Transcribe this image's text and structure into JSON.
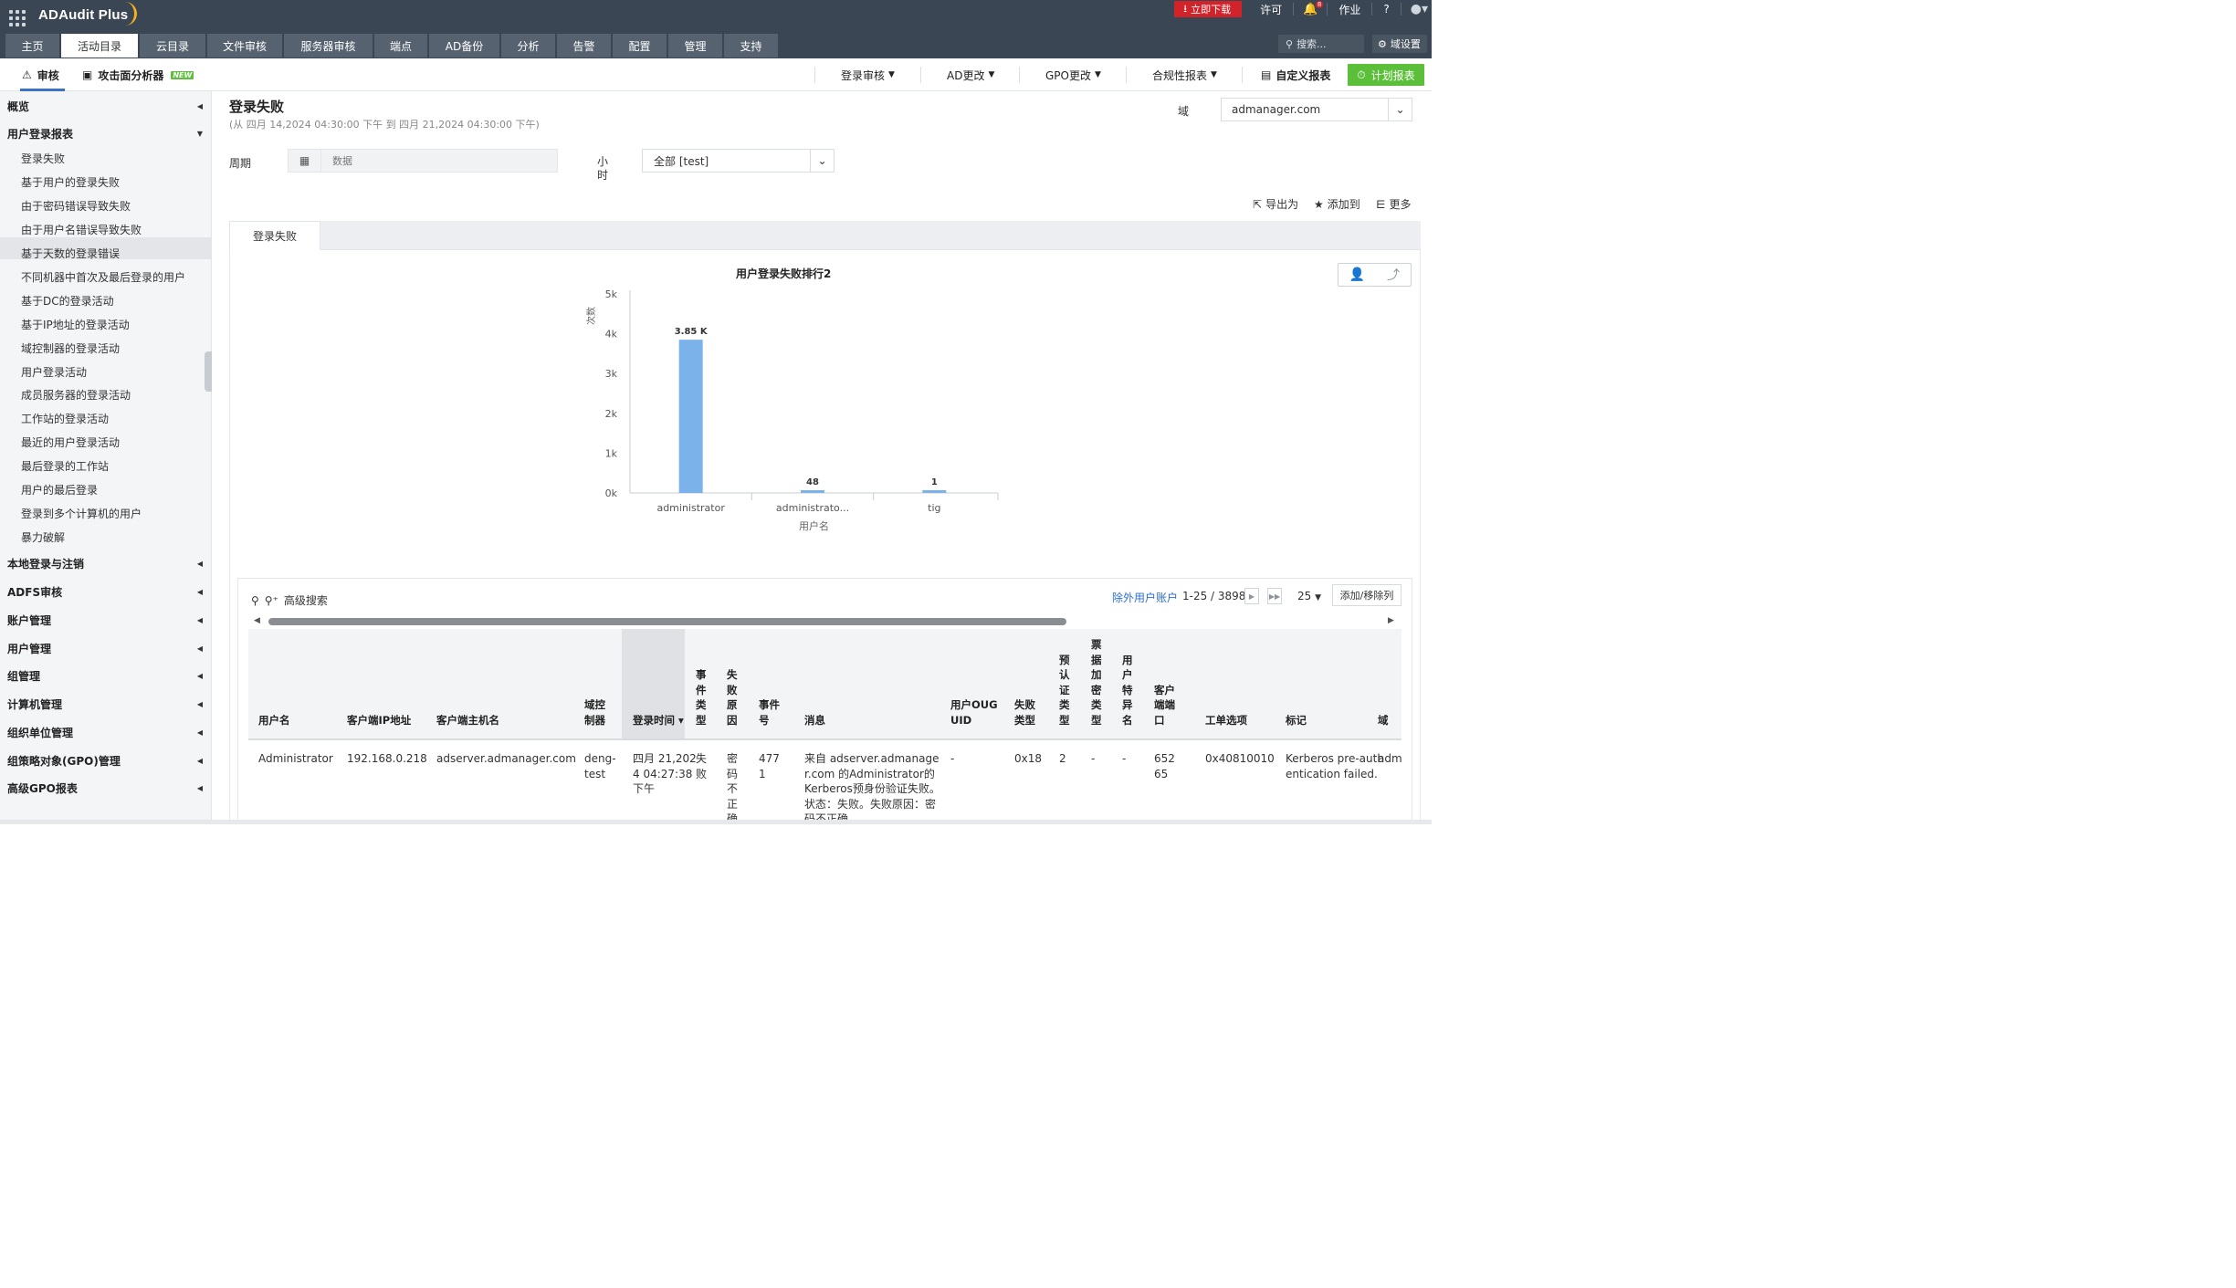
{
  "app": {
    "name": "ADAudit Plus"
  },
  "topbar": {
    "download_label": "立即下载",
    "license_label": "许可",
    "notification_count": "8",
    "jobs_label": "作业",
    "help_label": "?",
    "search_placeholder": "搜索...",
    "domain_settings_label": "域设置"
  },
  "nav_tabs": [
    {
      "label": "主页"
    },
    {
      "label": "活动目录"
    },
    {
      "label": "云目录"
    },
    {
      "label": "文件审核"
    },
    {
      "label": "服务器审核"
    },
    {
      "label": "端点"
    },
    {
      "label": "AD备份"
    },
    {
      "label": "分析"
    },
    {
      "label": "告警"
    },
    {
      "label": "配置"
    },
    {
      "label": "管理"
    },
    {
      "label": "支持"
    }
  ],
  "subbar": {
    "audit_label": "审核",
    "attack_label": "攻击面分析器",
    "new_badge": "NEW",
    "menus": [
      {
        "label": "登录审核"
      },
      {
        "label": "AD更改"
      },
      {
        "label": "GPO更改"
      },
      {
        "label": "合规性报表"
      }
    ],
    "custom_report_label": "自定义报表",
    "schedule_label": "计划报表"
  },
  "sidebar": {
    "overview": "概览",
    "user_login_reports": "用户登录报表",
    "items": [
      "登录失败",
      "基于用户的登录失败",
      "由于密码错误导致失败",
      "由于用户名错误导致失败",
      "基于天数的登录错误",
      "不同机器中首次及最后登录的用户",
      "基于DC的登录活动",
      "基于IP地址的登录活动",
      "域控制器的登录活动",
      "用户登录活动",
      "成员服务器的登录活动",
      "工作站的登录活动",
      "最近的用户登录活动",
      "最后登录的工作站",
      "用户的最后登录",
      "登录到多个计算机的用户",
      "暴力破解"
    ],
    "sections": [
      "本地登录与注销",
      "ADFS审核",
      "账户管理",
      "用户管理",
      "组管理",
      "计算机管理",
      "组织单位管理",
      "组策略对象(GPO)管理",
      "高级GPO报表"
    ]
  },
  "report": {
    "title": "登录失败",
    "range": "(从 四月 14,2024 04:30:00 下午 到 四月 21,2024 04:30:00 下午)",
    "domain_label": "域",
    "domain_value": "admanager.com",
    "period_label": "周期",
    "period_value": "数据",
    "hour_label": "小时",
    "hour_value": "全部 [test]",
    "export_label": "导出为",
    "add_to_label": "添加到",
    "more_label": "更多",
    "tab_label": "登录失败"
  },
  "chart_data": {
    "type": "bar",
    "title": "用户登录失败排行2",
    "categories": [
      "administrator",
      "administrato...",
      "tig"
    ],
    "values": [
      3850,
      48,
      1
    ],
    "data_labels": [
      "3.85 K",
      "48",
      "1"
    ],
    "xlabel": "用户名",
    "ylabel": "次数",
    "ylim": [
      0,
      5000
    ],
    "yticks": [
      "0k",
      "1k",
      "2k",
      "3k",
      "4k",
      "5k"
    ],
    "color": "#7cb2ea"
  },
  "grid": {
    "advanced_search": "高级搜索",
    "exclude_label": "除外用户账户",
    "pager_text": "1-25 / 3898",
    "per_page": "25",
    "add_remove_columns": "添加/移除列",
    "columns": [
      "用户名",
      "客户端IP地址",
      "客户端主机名",
      "域控制器",
      "登录时间",
      "事件类型",
      "失败原因",
      "事件号",
      "消息",
      "用户OUGUID",
      "失败类型",
      "预认证类型",
      "票据加密类型",
      "用户特异名",
      "客户端端口",
      "工单选项",
      "标记",
      "域"
    ],
    "rows": [
      {
        "user": "Administrator",
        "ip": "192.168.0.218",
        "host": "adserver.admanager.com",
        "dc": "deng-test",
        "time": "四月 21,2024 04:27:38 下午",
        "event_type": "失败",
        "reason": "密码不正确",
        "event_id": "4771",
        "message": "来自 adserver.admanager.com 的Administrator的 Kerberos预身份验证失败。状态：失败。失败原因：密码不正确",
        "ouguid": "-",
        "fail_type": "0x18",
        "preauth": "2",
        "ticket_enc": "-",
        "dn": "-",
        "port": "65265",
        "options": "0x40810010",
        "tag": "Kerberos pre-authentication failed.",
        "domain": "admanager.com"
      }
    ]
  },
  "colors": {
    "topbar": "#3b4654",
    "accent_green": "#5cbf3a",
    "download_red": "#d3232a",
    "link_blue": "#2c6fcf"
  }
}
